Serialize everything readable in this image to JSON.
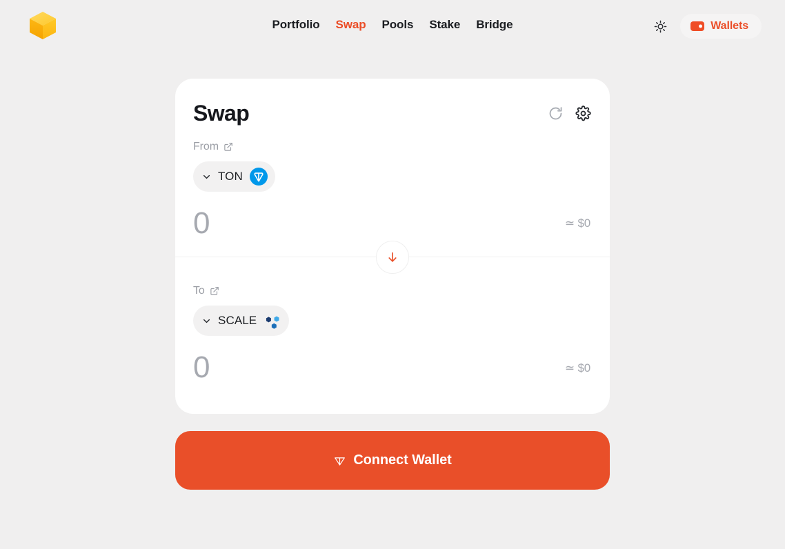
{
  "header": {
    "logo_icon": "cube-logo-icon",
    "nav": [
      {
        "label": "Portfolio",
        "active": false
      },
      {
        "label": "Swap",
        "active": true
      },
      {
        "label": "Pools",
        "active": false
      },
      {
        "label": "Stake",
        "active": false
      },
      {
        "label": "Bridge",
        "active": false
      }
    ],
    "theme_toggle_icon": "sun-icon",
    "wallets": {
      "label": "Wallets",
      "icon": "wallet-icon"
    }
  },
  "swap_card": {
    "title": "Swap",
    "refresh_icon": "refresh-icon",
    "settings_icon": "gear-icon",
    "from": {
      "label": "From",
      "external_link_icon": "external-link-icon",
      "token": {
        "symbol": "TON",
        "logo_icon": "ton-token-icon",
        "chevron_icon": "chevron-down-icon"
      },
      "amount_value": "",
      "amount_placeholder": "0",
      "usd_value": "≃ $0"
    },
    "swap_direction_icon": "arrow-down-icon",
    "to": {
      "label": "To",
      "external_link_icon": "external-link-icon",
      "token": {
        "symbol": "SCALE",
        "logo_icon": "scale-token-icon",
        "chevron_icon": "chevron-down-icon"
      },
      "amount_value": "",
      "amount_placeholder": "0",
      "usd_value": "≃ $0"
    }
  },
  "connect": {
    "label": "Connect Wallet",
    "icon": "ton-diamond-icon"
  },
  "colors": {
    "accent": "#e94f29",
    "page_background": "#f0efef",
    "card_background": "#ffffff",
    "muted_text": "#9b9ea5",
    "ton_blue": "#0098ea",
    "logo_gold": "#ffbe0b"
  }
}
